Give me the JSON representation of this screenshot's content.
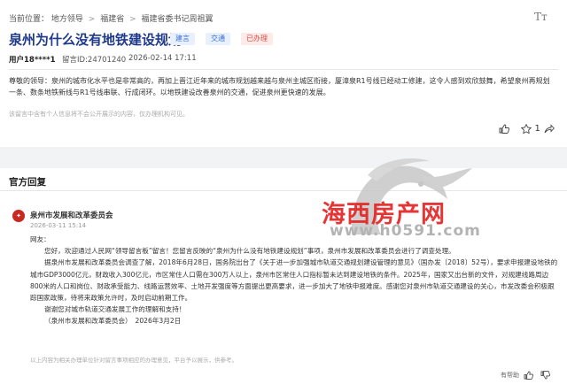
{
  "breadcrumb": {
    "label": "当前位置：",
    "items": [
      "地方领导",
      "福建省",
      "福建省委书记周祖翼"
    ]
  },
  "font_toggle": "Tт",
  "message": {
    "title": "泉州为什么没有地铁建设规划",
    "tags": [
      "建言",
      "交通",
      "已办理"
    ],
    "user": "用户18****1",
    "id_text": "留言ID:24701240",
    "time": "2026-02-14 17:11",
    "body": "尊敬的领导：泉州的城市化水平也是非常高的，再加上晋江近年来的城市规划越来越与泉州主城区衔接，厦漳泉R1号线已经动工修建，这令人感到欢欣鼓舞，希望泉州再规划一条、数条地铁新线与R1号线串联、行成闭环。以地铁建设改善泉州的交通，促进泉州更快速的发展。",
    "note": "该留言中含有个人信息将不会公开展示的内容，仅办理机构可见。",
    "like_count": "1"
  },
  "reply_section": {
    "title": "官方回复",
    "department": "泉州市发展和改革委员会",
    "time": "2026-03-11 15:14",
    "paragraphs": [
      "网友：",
      "您好，欢迎通过人民网“领导留言板”留言！您留言反映的“泉州为什么没有地铁建设规划”事项，泉州市发展和改革委员会进行了调查处理。",
      "据泉州市发展和改革委员会调查了解，2018年6月28日，国务院出台了《关于进一步加强城市轨道交通规划建设管理的意见》（国办发〔2018〕52号），要求申报建设地铁的城市GDP3000亿元，财政收入300亿元，市区常住人口需在300万人以上，泉州市区常住人口指标暂未达到建设地铁的条件。2025年，国家又出台新的文件，对规建线路周边800米的人口和岗位、财政承受能力、线路运营效率、土地开发强度等方面提出更高要求，进一步加大了地铁申报难度。感谢您对泉州市轨道交通建设的关心，市发改委会积极跟踪国家政策，待将来政策允许时，及时启动前期工作。",
      "谢谢您对城市轨道交通发展工作的理解和支持！",
      "（泉州市发展和改革委员会）　2026年3月2日"
    ],
    "footer_note": "以上内容为相关办理单位针对留言事项相应的办理意见，平台予以展示，供参考。",
    "helpful_label": "有帮助"
  },
  "watermark": {
    "text": "海西房产网",
    "url": "www.h0591.com"
  },
  "colors": {
    "title": "#1f3a8a",
    "tag_blue": "#3a6fd8",
    "tag_red": "#e04a3e",
    "watermark": "#e52020"
  }
}
